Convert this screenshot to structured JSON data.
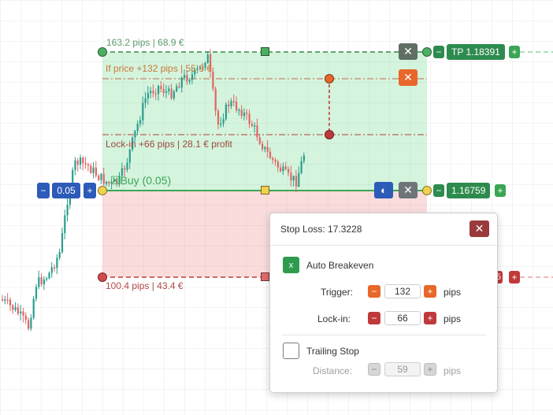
{
  "colors": {
    "tp_green": "#2e8b4e",
    "sl_red": "#c0393b",
    "orange": "#e8672a",
    "blue": "#2d5bb8",
    "gray": "#6f7478",
    "yellow": "#f2d14b",
    "entry_line": "#3aa655"
  },
  "tp": {
    "info": "163.2 pips | 68.9 €",
    "price_label": "TP 1.18391",
    "minus": "−",
    "plus": "+"
  },
  "breakeven_trigger_line": {
    "info": "If price +132 pips | 55.9 €"
  },
  "lockin_line": {
    "info": "Lock-in +66 pips | 28.1 € profit"
  },
  "entry": {
    "label": "Buy (0.05)",
    "price": "1.16759",
    "lot_minus": "−",
    "lot_value": "0.05",
    "lot_plus": "+",
    "minus": "−",
    "plus": "+"
  },
  "sl": {
    "info": "100.4 pips | 43.4 €",
    "plus": "+"
  },
  "panel": {
    "title": "Stop Loss: 17.3228",
    "close": "✕",
    "auto_breakeven": {
      "checked_mark": "x",
      "label": "Auto Breakeven"
    },
    "trigger": {
      "label": "Trigger:",
      "minus": "−",
      "value": "132",
      "plus": "+",
      "unit": "pips"
    },
    "lockin": {
      "label": "Lock-in:",
      "minus": "−",
      "value": "66",
      "plus": "+",
      "unit": "pips"
    },
    "trailing_stop": {
      "label": "Trailing Stop"
    },
    "distance": {
      "label": "Distance:",
      "minus": "−",
      "value": "59",
      "plus": "+",
      "unit": "pips"
    }
  },
  "icons": {
    "close_icon": "✕",
    "theme_icon": "◐",
    "buy_icon": "☒"
  }
}
